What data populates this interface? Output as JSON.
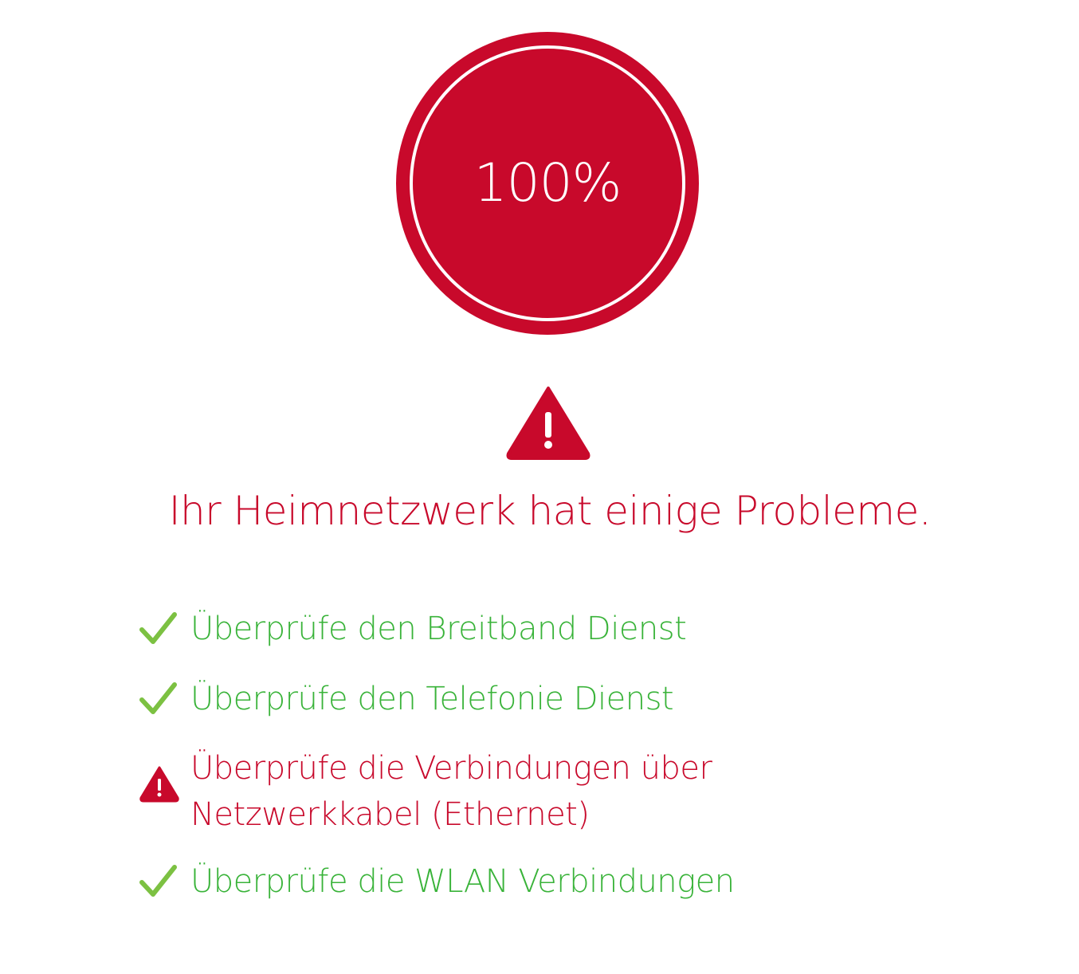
{
  "progress": {
    "value_text": "100%",
    "percent": 100
  },
  "status": {
    "icon": "warning-triangle-icon",
    "headline": "Ihr Heimnetzwerk hat einige Probleme."
  },
  "checks": [
    {
      "label": "Überprüfe den Breitband Dienst",
      "status": "ok",
      "icon": "checkmark-icon"
    },
    {
      "label": "Überprüfe den Telefonie Dienst",
      "status": "ok",
      "icon": "checkmark-icon"
    },
    {
      "label": "Überprüfe die Verbindungen über Netzwerkkabel (Ethernet)",
      "status": "warning",
      "icon": "warning-triangle-icon"
    },
    {
      "label": "Überprüfe die WLAN Verbindungen",
      "status": "ok",
      "icon": "checkmark-icon"
    }
  ],
  "colors": {
    "brand_red": "#c8092b",
    "success_green": "#39b339",
    "check_green": "#7cc142"
  }
}
